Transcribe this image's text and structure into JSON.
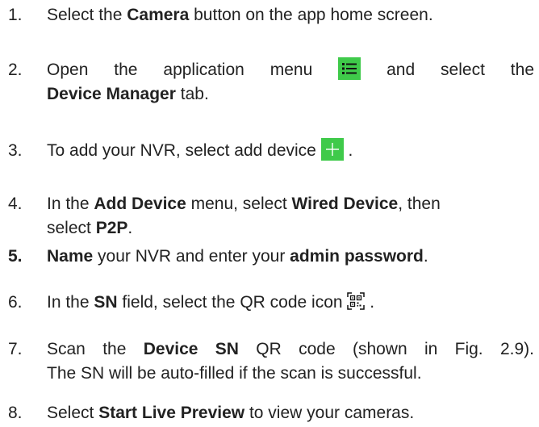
{
  "steps": [
    {
      "number": "1.",
      "p1": "Select the ",
      "b1": "Camera",
      "p2": " button on the app home screen."
    },
    {
      "number": "2.",
      "p1": "Open the application menu ",
      "icon": "menu-list-icon",
      "p2": " and select the",
      "b1": "Device Manager",
      "p3": " tab."
    },
    {
      "number": "3.",
      "p1": "To add your NVR, select add device ",
      "icon": "plus-icon",
      "p2": " ."
    },
    {
      "number": "4.",
      "p1": "In the ",
      "b1": "Add Device",
      "p2": " menu, select ",
      "b2": "Wired Device",
      "p3": ", then",
      "p4": "select ",
      "b3": "P2P",
      "p5": "."
    },
    {
      "number": "5.",
      "b1": "Name",
      "p1": " your NVR and enter your ",
      "b2": "admin password",
      "p2": "."
    },
    {
      "number": "6.",
      "p1": "In the ",
      "b1": "SN",
      "p2": " field, select the QR code icon ",
      "icon": "qr-code-icon",
      "p3": " ."
    },
    {
      "number": "7.",
      "p1": "Scan the ",
      "b1": "Device SN",
      "p2": " QR code (shown in Fig. 2.9).",
      "line2": "The SN will be auto-filled if the scan is successful."
    },
    {
      "number": "8.",
      "p1": "Select ",
      "b1": "Start Live Preview",
      "p2": " to view your cameras."
    }
  ],
  "colors": {
    "icon_accent": "#3fca4a",
    "text": "#222222"
  }
}
